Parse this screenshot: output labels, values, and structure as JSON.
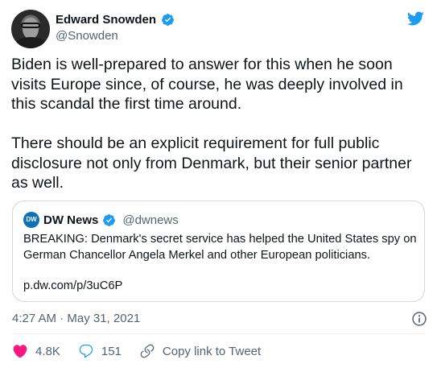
{
  "author": {
    "name": "Edward Snowden",
    "handle": "@Snowden"
  },
  "tweet": {
    "text": "Biden is well-prepared to answer for this when he soon visits Europe since, of course, he was deeply involved in this scandal the first time around.\n\nThere should be an explicit requirement for full public disclosure not only from Denmark, but their senior partner as well."
  },
  "quoted": {
    "logo_text": "DW",
    "name": "DW News",
    "handle": "@dwnews",
    "text": "BREAKING: Denmark's secret service has helped the United States spy on German Chancellor Angela Merkel and other European politicians.",
    "link": "p.dw.com/p/3uC6P"
  },
  "meta": {
    "timestamp": "4:27 AM · May 31, 2021"
  },
  "actions": {
    "likes": "4.8K",
    "replies": "151",
    "copy_link": "Copy link to Tweet"
  },
  "colors": {
    "brand": "#1d9bf0",
    "secondary_text": "#536471",
    "like": "#f91880",
    "border": "#cfd9de"
  }
}
